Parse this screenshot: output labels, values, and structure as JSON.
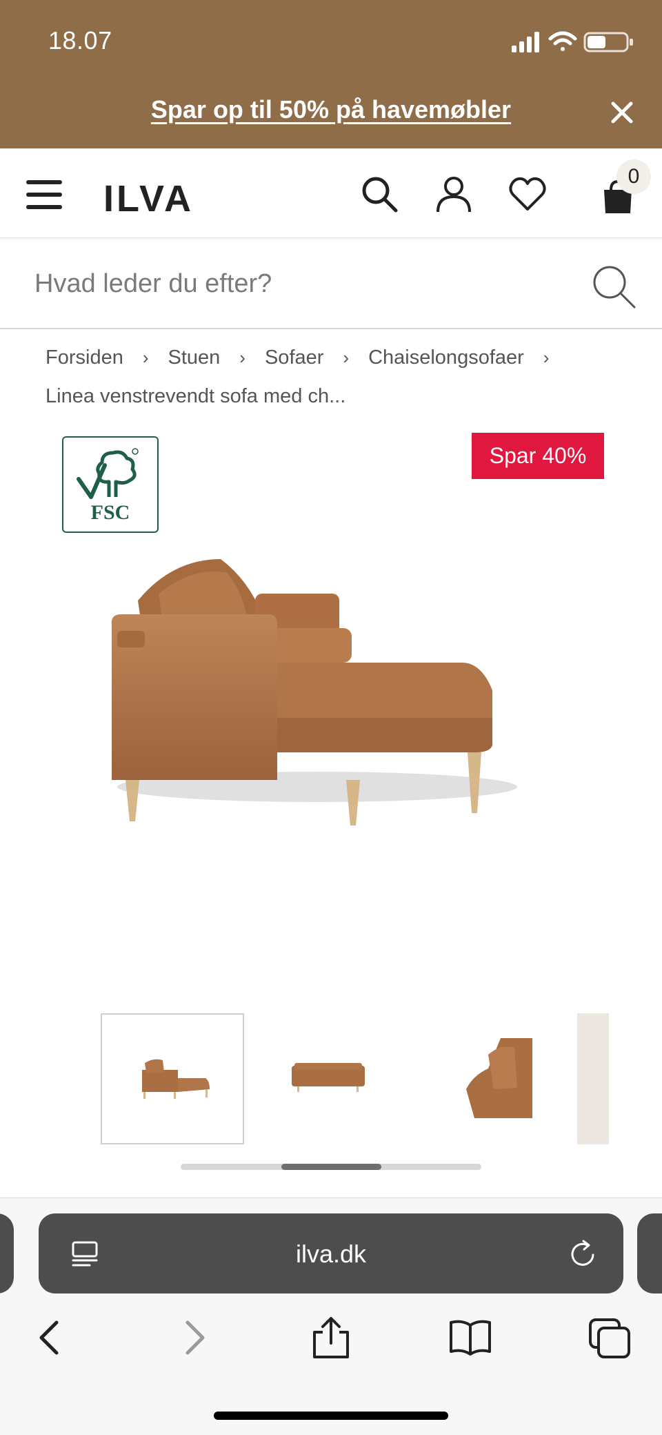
{
  "status": {
    "time": "18.07"
  },
  "promo": {
    "text": "Spar op til 50% på havemøbler"
  },
  "header": {
    "logo": "ILVA",
    "cart_count": "0"
  },
  "search": {
    "placeholder": "Hvad leder du efter?"
  },
  "breadcrumb": {
    "items": [
      "Forsiden",
      "Stuen",
      "Sofaer",
      "Chaiselongsofaer",
      "Linea venstrevendt sofa med ch..."
    ],
    "separator": "›"
  },
  "product": {
    "badge": "Spar 40%",
    "certification": "FSC",
    "gallery_position": 0.34
  },
  "browser": {
    "url": "ilva.dk"
  },
  "colors": {
    "banner": "#8f6d48",
    "badge": "#e0173f",
    "leather": "#b0764a"
  }
}
